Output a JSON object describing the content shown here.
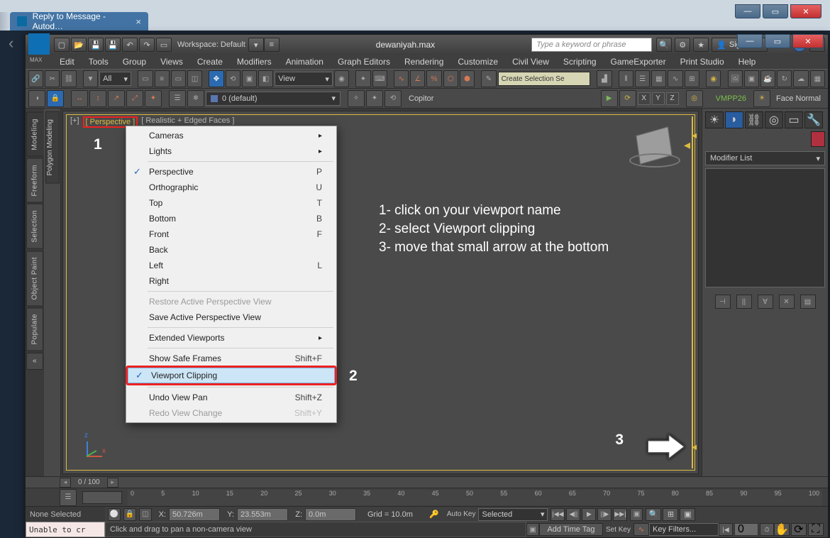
{
  "browser": {
    "tab_title": "Reply to Message - Autod…"
  },
  "title_bar": {
    "workspace_label": "Workspace: Default",
    "file_name": "dewaniyah.max",
    "search_placeholder": "Type a keyword or phrase",
    "signin_label": "Sign In"
  },
  "menu": [
    "Edit",
    "Tools",
    "Group",
    "Views",
    "Create",
    "Modifiers",
    "Animation",
    "Graph Editors",
    "Rendering",
    "Customize",
    "Civil View",
    "Scripting",
    "GameExporter",
    "Print Studio",
    "Help"
  ],
  "toolbar1": {
    "filter_dropdown": "All",
    "view_dropdown": "View",
    "create_sel_set": "Create Selection Se"
  },
  "toolbar2": {
    "layer_label": "0 (default)",
    "copitor": "Copitor",
    "x": "X",
    "y": "Y",
    "z": "Z",
    "vmpp": "VMPP26",
    "face_normal": "Face Normal"
  },
  "left_tabs": [
    "Modeling",
    "Freeform",
    "Selection",
    "Object Paint",
    "Populate"
  ],
  "left_tab_inner": "Polygon Modeling",
  "viewport": {
    "label_left": "[+]",
    "label_name": "[ Perspective ]",
    "label_mode": "[ Realistic + Edged Faces ]"
  },
  "ctx": {
    "cameras": "Cameras",
    "lights": "Lights",
    "persp": "Perspective",
    "persp_key": "P",
    "ortho": "Orthographic",
    "ortho_key": "U",
    "top": "Top",
    "top_key": "T",
    "bottom": "Bottom",
    "bottom_key": "B",
    "front": "Front",
    "front_key": "F",
    "back": "Back",
    "left": "Left",
    "left_key": "L",
    "right": "Right",
    "restore": "Restore Active Perspective View",
    "save": "Save Active Perspective View",
    "extended": "Extended Viewports",
    "safeframes": "Show Safe Frames",
    "safeframes_key": "Shift+F",
    "vpclip": "Viewport Clipping",
    "undo": "Undo View Pan",
    "undo_key": "Shift+Z",
    "redo": "Redo View Change",
    "redo_key": "Shift+Y"
  },
  "help_text": {
    "l1": "1- click on your viewport name",
    "l2": "2- select Viewport clipping",
    "l3": "3- move that small arrow at the bottom"
  },
  "annotations": {
    "a1": "1",
    "a2": "2",
    "a3": "3"
  },
  "cmd_panel": {
    "modifier_list": "Modifier List"
  },
  "timebar": {
    "scroll_ind": "0 / 100",
    "ticks": [
      "0",
      "5",
      "10",
      "15",
      "20",
      "25",
      "30",
      "35",
      "40",
      "45",
      "50",
      "55",
      "60",
      "65",
      "70",
      "75",
      "80",
      "85",
      "90",
      "95",
      "100"
    ]
  },
  "status": {
    "none_selected": "None Selected",
    "x_label": "X:",
    "x_val": "50.726m",
    "y_label": "Y:",
    "y_val": "23.553m",
    "z_label": "Z:",
    "z_val": "0.0m",
    "grid": "Grid = 10.0m",
    "auto_key": "Auto Key",
    "set_key": "Set Key",
    "selected": "Selected",
    "key_filters": "Key Filters...",
    "frame": "0",
    "maxscript": "Unable to cr",
    "prompt": "Click and drag to pan a non-camera view",
    "add_time_tag": "Add Time Tag"
  }
}
